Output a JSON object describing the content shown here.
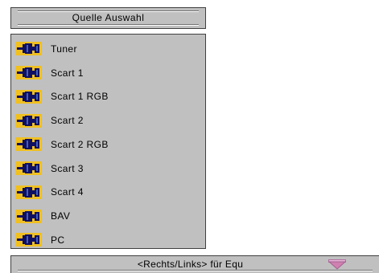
{
  "menu": {
    "title": "Quelle Auswahl",
    "sources": [
      {
        "label": "Tuner",
        "icon": "connector-icon"
      },
      {
        "label": "Scart 1",
        "icon": "connector-icon"
      },
      {
        "label": "Scart 1 RGB",
        "icon": "connector-icon"
      },
      {
        "label": "Scart 2",
        "icon": "connector-icon"
      },
      {
        "label": "Scart 2 RGB",
        "icon": "connector-icon"
      },
      {
        "label": "Scart 3",
        "icon": "connector-icon"
      },
      {
        "label": "Scart 4",
        "icon": "connector-icon"
      },
      {
        "label": "BAV",
        "icon": "connector-icon"
      },
      {
        "label": "PC",
        "icon": "connector-icon"
      }
    ]
  },
  "hint": {
    "text": "<Rechts/Links> für Equ",
    "arrow_icon": "chevron-down-icon"
  },
  "colors": {
    "panel": "#c0c0c0",
    "icon_yellow": "#f0c020",
    "icon_dark": "#101060",
    "arrow_pink": "#d080b0"
  }
}
